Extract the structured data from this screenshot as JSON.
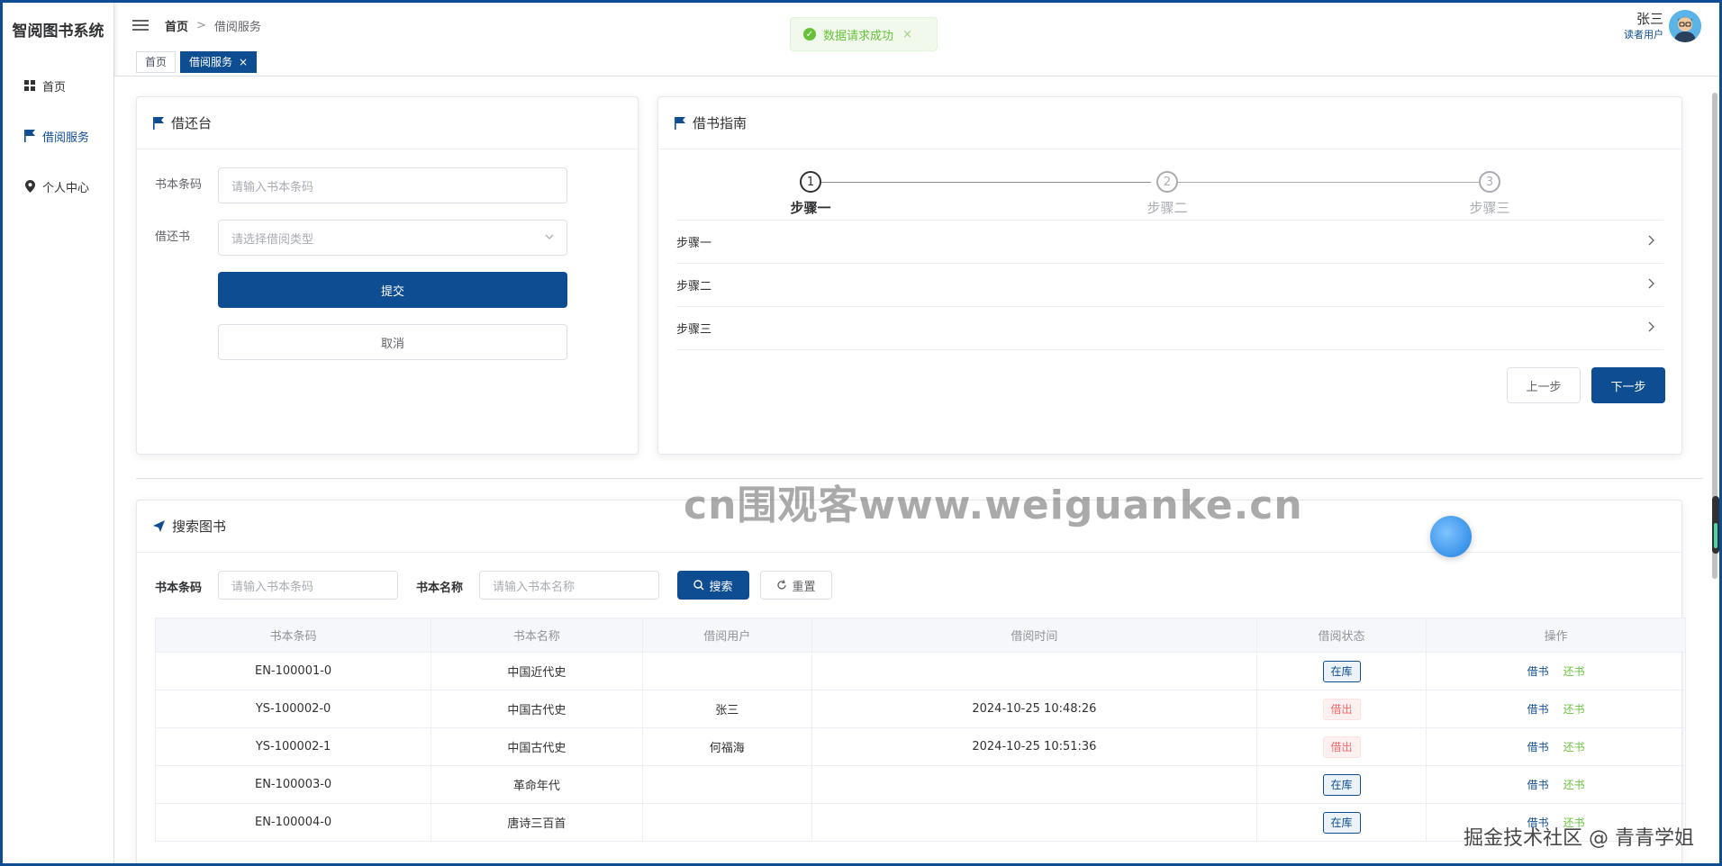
{
  "app": {
    "title": "智阅图书系统"
  },
  "sidebar": {
    "items": [
      {
        "label": "首页",
        "icon": "grid-icon",
        "active": false
      },
      {
        "label": "借阅服务",
        "icon": "flag-icon",
        "active": true
      },
      {
        "label": "个人中心",
        "icon": "location-pin-icon",
        "active": false
      }
    ]
  },
  "header": {
    "breadcrumb": {
      "home": "首页",
      "sep": ">",
      "current": "借阅服务"
    },
    "user": {
      "name": "张三",
      "role": "读者用户"
    }
  },
  "toast": {
    "text": "数据请求成功",
    "close": "×"
  },
  "tags": [
    {
      "label": "首页",
      "active": false
    },
    {
      "label": "借阅服务",
      "active": true,
      "close": "×"
    }
  ],
  "borrow_desk": {
    "title": "借还台",
    "barcode_label": "书本条码",
    "barcode_placeholder": "请输入书本条码",
    "type_label": "借还书",
    "type_placeholder": "请选择借阅类型",
    "submit": "提交",
    "cancel": "取消"
  },
  "guide": {
    "title": "借书指南",
    "steps": [
      {
        "num": "1",
        "label": "步骤一",
        "active": true
      },
      {
        "num": "2",
        "label": "步骤二",
        "active": false
      },
      {
        "num": "3",
        "label": "步骤三",
        "active": false
      }
    ],
    "collapse": [
      "步骤一",
      "步骤二",
      "步骤三"
    ],
    "prev": "上一步",
    "next": "下一步"
  },
  "search": {
    "title": "搜索图书",
    "barcode_label": "书本条码",
    "barcode_placeholder": "请输入书本条码",
    "name_label": "书本名称",
    "name_placeholder": "请输入书本名称",
    "search_btn": "搜索",
    "reset_btn": "重置"
  },
  "table": {
    "columns": [
      "书本条码",
      "书本名称",
      "借阅用户",
      "借阅时间",
      "借阅状态",
      "操作"
    ],
    "rows": [
      {
        "barcode": "EN-100001-0",
        "name": "中国近代史",
        "user": "",
        "time": "",
        "status": "在库",
        "status_type": "in"
      },
      {
        "barcode": "YS-100002-0",
        "name": "中国古代史",
        "user": "张三",
        "time": "2024-10-25 10:48:26",
        "status": "借出",
        "status_type": "out"
      },
      {
        "barcode": "YS-100002-1",
        "name": "中国古代史",
        "user": "何福海",
        "time": "2024-10-25 10:51:36",
        "status": "借出",
        "status_type": "out"
      },
      {
        "barcode": "EN-100003-0",
        "name": "革命年代",
        "user": "",
        "time": "",
        "status": "在库",
        "status_type": "in"
      },
      {
        "barcode": "EN-100004-0",
        "name": "唐诗三百首",
        "user": "",
        "time": "",
        "status": "在库",
        "status_type": "in"
      }
    ],
    "op_borrow": "借书",
    "op_return": "还书"
  },
  "watermarks": {
    "center": "cn围观客www.weiguanke.cn",
    "corner": "掘金技术社区 @ 青青学姐"
  },
  "colors": {
    "primary": "#0e4d92",
    "success": "#67c23a",
    "danger": "#f56c6c"
  }
}
